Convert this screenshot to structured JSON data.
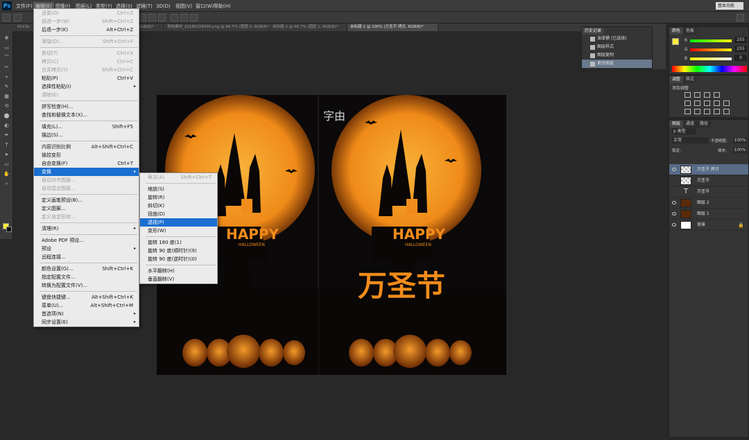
{
  "app": {
    "logo": "Ps",
    "workspace": "基本功能"
  },
  "menubar": [
    "文件(F)",
    "编辑(E)",
    "图像(I)",
    "图层(L)",
    "类型(Y)",
    "选择(S)",
    "滤镜(T)",
    "3D(D)",
    "视图(V)",
    "窗口(W)",
    "帮助(H)"
  ],
  "tabs": [
    {
      "label": "6521b"
    },
    {
      "label": "g.png @ 100%(RGB/8)*"
    },
    {
      "label": "未标题-1 @ 100% (万圣节, RGB/8)*"
    },
    {
      "label": "青蛙素材_20180104090.png @ 66.7% (图层 0, RGB/8)*"
    },
    {
      "label": "未标题-2 @ 66.7% (图层 1, RGB/8)*"
    },
    {
      "label": "未标题-1 @ 100% (万圣节 拷贝, RGB/8)*"
    }
  ],
  "edit_menu": {
    "items": [
      {
        "label": "还原(O)",
        "shortcut": "Ctrl+Z",
        "disabled": true
      },
      {
        "label": "前进一步(W)",
        "shortcut": "Shift+Ctrl+Z",
        "disabled": true
      },
      {
        "label": "后退一步(K)",
        "shortcut": "Alt+Ctrl+Z"
      },
      {
        "sep": true
      },
      {
        "label": "渐隐(D)...",
        "shortcut": "Shift+Ctrl+F",
        "disabled": true
      },
      {
        "sep": true
      },
      {
        "label": "剪切(T)",
        "shortcut": "Ctrl+X",
        "disabled": true
      },
      {
        "label": "拷贝(C)",
        "shortcut": "Ctrl+C",
        "disabled": true
      },
      {
        "label": "合并拷贝(Y)",
        "shortcut": "Shift+Ctrl+C",
        "disabled": true
      },
      {
        "label": "粘贴(P)",
        "shortcut": "Ctrl+V"
      },
      {
        "label": "选择性粘贴(I)",
        "submenu": true
      },
      {
        "label": "清除(E)",
        "disabled": true
      },
      {
        "sep": true
      },
      {
        "label": "拼写检查(H)..."
      },
      {
        "label": "查找和替换文本(X)..."
      },
      {
        "sep": true
      },
      {
        "label": "填充(L)...",
        "shortcut": "Shift+F5"
      },
      {
        "label": "描边(S)..."
      },
      {
        "sep": true
      },
      {
        "label": "内容识别比例",
        "shortcut": "Alt+Shift+Ctrl+C"
      },
      {
        "label": "操控变形"
      },
      {
        "label": "自由变换(F)",
        "shortcut": "Ctrl+T"
      },
      {
        "label": "变换",
        "submenu": true,
        "highlight": true
      },
      {
        "label": "自动对齐图层...",
        "disabled": true
      },
      {
        "label": "自动混合图层...",
        "disabled": true
      },
      {
        "sep": true
      },
      {
        "label": "定义画笔预设(B)..."
      },
      {
        "label": "定义图案..."
      },
      {
        "label": "定义自定形状...",
        "disabled": true
      },
      {
        "sep": true
      },
      {
        "label": "清理(R)",
        "submenu": true
      },
      {
        "sep": true
      },
      {
        "label": "Adobe PDF 预设..."
      },
      {
        "label": "预设",
        "submenu": true
      },
      {
        "label": "远程连接..."
      },
      {
        "sep": true
      },
      {
        "label": "颜色设置(G)...",
        "shortcut": "Shift+Ctrl+K"
      },
      {
        "label": "指定配置文件..."
      },
      {
        "label": "转换为配置文件(V)..."
      },
      {
        "sep": true
      },
      {
        "label": "键盘快捷键...",
        "shortcut": "Alt+Shift+Ctrl+K"
      },
      {
        "label": "菜单(U)...",
        "shortcut": "Alt+Shift+Ctrl+M"
      },
      {
        "label": "首选项(N)",
        "submenu": true
      },
      {
        "label": "同步设置(E)",
        "submenu": true
      }
    ]
  },
  "transform_menu": {
    "items": [
      {
        "label": "再次(A)",
        "shortcut": "Shift+Ctrl+T",
        "disabled": true
      },
      {
        "sep": true
      },
      {
        "label": "缩放(S)"
      },
      {
        "label": "旋转(R)"
      },
      {
        "label": "斜切(K)"
      },
      {
        "label": "扭曲(D)"
      },
      {
        "label": "透视(P)",
        "highlight": true
      },
      {
        "label": "变形(W)"
      },
      {
        "sep": true
      },
      {
        "label": "旋转 180 度(1)"
      },
      {
        "label": "旋转 90 度(顺时针)(9)"
      },
      {
        "label": "旋转 90 度(逆时针)(0)"
      },
      {
        "sep": true
      },
      {
        "label": "水平翻转(H)"
      },
      {
        "label": "垂直翻转(V)"
      }
    ]
  },
  "canvas": {
    "left_badge": "HAPPY",
    "left_sub": "HALLOWEEN",
    "right_badge": "HAPPY",
    "right_sub": "HALLOWEEN",
    "title": "万圣节",
    "logo_text": "字由",
    "accent": "#f28c1a",
    "moon": "#f5a623"
  },
  "history_panel": {
    "tabs": [
      "历史记录"
    ],
    "items": [
      "油漆桶  (已选择)",
      "图层样式",
      "图层复制",
      "更改图层"
    ]
  },
  "color_panel": {
    "tabs": [
      "颜色",
      "色板"
    ],
    "r": "255",
    "g": "255",
    "b": "0"
  },
  "adjust_panel": {
    "tabs": [
      "调整",
      "样式"
    ],
    "title": "添加调整"
  },
  "layers_panel": {
    "tabs": [
      "图层",
      "通道",
      "路径"
    ],
    "kind": "p 类型",
    "blend": "正常",
    "opacity_label": "不透明度:",
    "opacity": "100%",
    "lock_label": "锁定:",
    "fill_label": "填充:",
    "fill": "100%",
    "layers": [
      {
        "name": "万圣节 拷贝",
        "sel": true,
        "eye": true
      },
      {
        "name": "万圣节",
        "eye": false
      },
      {
        "name": "万圣节",
        "type": true,
        "eye": false
      },
      {
        "name": "图层 2",
        "eye": true
      },
      {
        "name": "图层 1",
        "eye": true
      },
      {
        "name": "背景",
        "eye": true,
        "locked": true
      }
    ]
  }
}
